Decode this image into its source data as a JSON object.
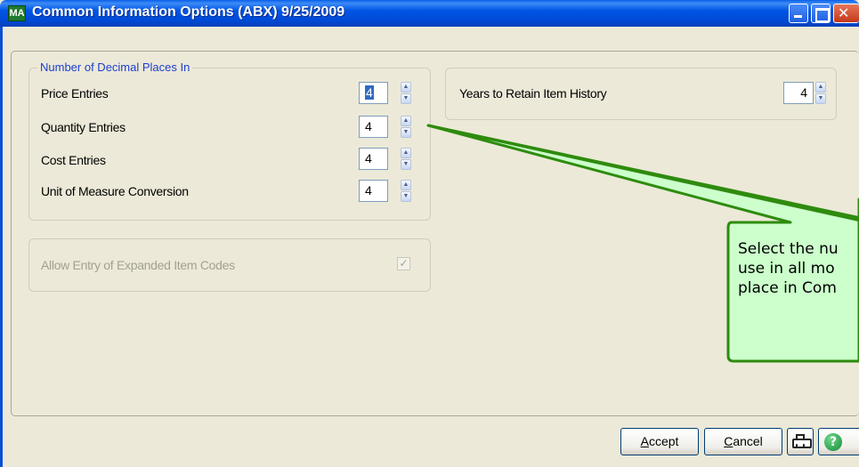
{
  "window": {
    "title": "Common Information Options (ABX) 9/25/2009",
    "app_icon_text": "MA"
  },
  "decimal_group": {
    "legend": "Number of Decimal Places In",
    "fields": [
      {
        "label": "Price Entries",
        "value": "4"
      },
      {
        "label": "Quantity Entries",
        "value": "4"
      },
      {
        "label": "Cost Entries",
        "value": "4"
      },
      {
        "label": "Unit of Measure Conversion",
        "value": "4"
      }
    ]
  },
  "expanded_codes": {
    "label": "Allow Entry of Expanded Item Codes",
    "checked": true,
    "check_glyph": "✓"
  },
  "history": {
    "label": "Years to Retain Item History",
    "value": "4"
  },
  "callout": {
    "lines": [
      "Select the nu",
      "use in all mo",
      "place in Com"
    ],
    "fill": "#CCFFCC",
    "stroke": "#2E8B0E"
  },
  "buttons": {
    "accept": {
      "prefix": "",
      "accel": "A",
      "suffix": "ccept"
    },
    "cancel": {
      "prefix": "",
      "accel": "C",
      "suffix": "ancel"
    },
    "help_glyph": "?"
  },
  "icons": {
    "spin_up": "▲",
    "spin_down": "▼"
  }
}
